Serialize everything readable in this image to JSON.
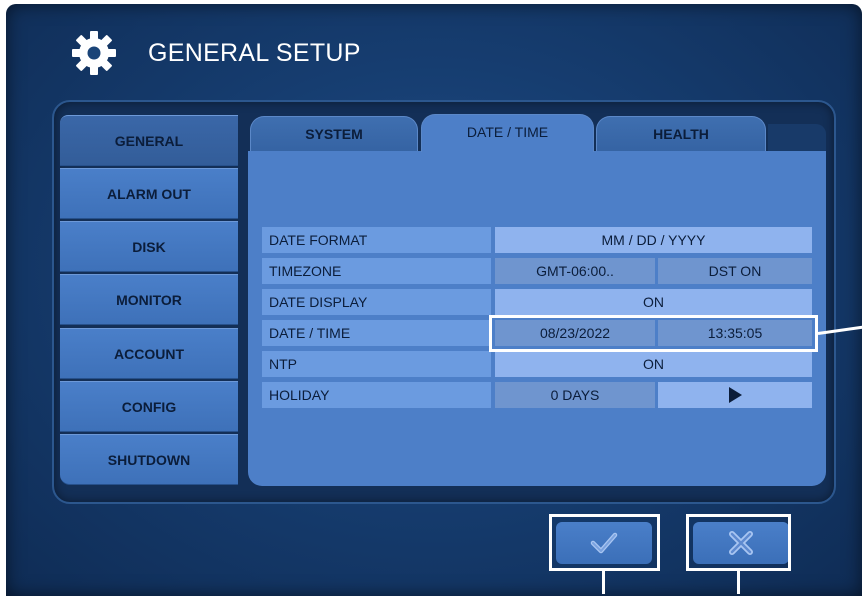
{
  "title": "GENERAL SETUP",
  "sidebar": {
    "items": [
      {
        "label": "GENERAL",
        "active": true
      },
      {
        "label": "ALARM OUT"
      },
      {
        "label": "DISK"
      },
      {
        "label": "MONITOR"
      },
      {
        "label": "ACCOUNT"
      },
      {
        "label": "CONFIG"
      },
      {
        "label": "SHUTDOWN"
      }
    ]
  },
  "tabs": [
    {
      "label": "SYSTEM"
    },
    {
      "label": "DATE / TIME",
      "active": true
    },
    {
      "label": "HEALTH"
    }
  ],
  "settings": {
    "date_format": {
      "label": "DATE FORMAT",
      "value": "MM / DD / YYYY"
    },
    "timezone": {
      "label": "TIMEZONE",
      "value": "GMT-06:00..",
      "dst": "DST ON"
    },
    "date_display": {
      "label": "DATE DISPLAY",
      "value": "ON"
    },
    "date_time": {
      "label": "DATE / TIME",
      "date": "08/23/2022",
      "time": "13:35:05"
    },
    "ntp": {
      "label": "NTP",
      "value": "ON"
    },
    "holiday": {
      "label": "HOLIDAY",
      "value": "0 DAYS",
      "button_icon": "play-icon"
    }
  },
  "buttons": {
    "confirm_icon": "checkmark-icon",
    "cancel_icon": "x-icon"
  },
  "colors": {
    "background": "#163d70",
    "panel": "#4d7fc8",
    "row_label": "#6b9be0",
    "row_value": "#8fb3ee",
    "text": "#0b1d3a",
    "highlight": "#ffffff"
  }
}
